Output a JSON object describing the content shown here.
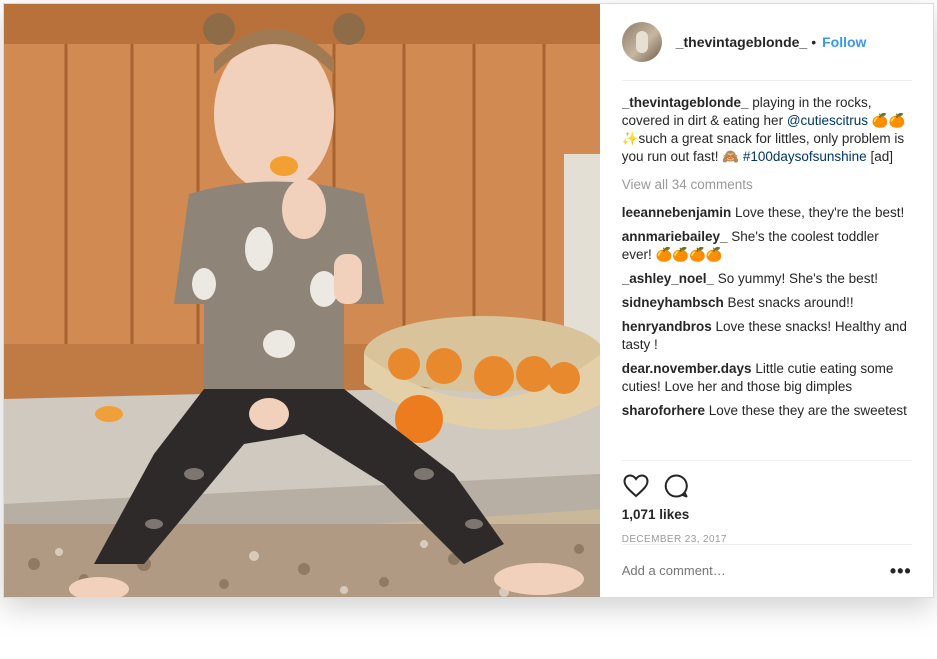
{
  "post": {
    "username": "_thevintageblonde_",
    "separator": "•",
    "follow_label": "Follow",
    "caption": {
      "user": "_thevintageblonde_",
      "text_before_mention": " playing in the rocks, covered in dirt & eating her ",
      "mention": "@cutiescitrus",
      "text_after_mention": " 🍊🍊✨such a great snack for littles, only problem is you run out fast! 🙈 ",
      "hashtag": "#100daysofsunshine",
      "text_end": " [ad]"
    },
    "view_all_comments": "View all 34 comments",
    "comments": [
      {
        "user": "leeannebenjamin",
        "text": "Love these, they're the best!"
      },
      {
        "user": "annmariebailey_",
        "text": "She's the coolest toddler ever! 🍊🍊🍊🍊"
      },
      {
        "user": "_ashley_noel_",
        "text": "So yummy! She's the best!"
      },
      {
        "user": "sidneyhambsch",
        "text": "Best snacks around!!"
      },
      {
        "user": "henryandbros",
        "text": "Love these snacks! Healthy and tasty !"
      },
      {
        "user": "dear.november.days",
        "text": "Little cutie eating some cuties! Love her and those big dimples"
      },
      {
        "user": "sharoforhere",
        "text": "Love these they are the sweetest"
      }
    ],
    "likes": "1,071 likes",
    "date": "DECEMBER 23, 2017",
    "add_comment_placeholder": "Add a comment…",
    "more_label": "•••",
    "icons": {
      "like": "heart-icon",
      "comment": "comment-bubble-icon",
      "more": "more-options-icon"
    }
  },
  "colors": {
    "link_blue": "#3897f0",
    "mention_blue": "#003569",
    "muted_gray": "#999999"
  }
}
